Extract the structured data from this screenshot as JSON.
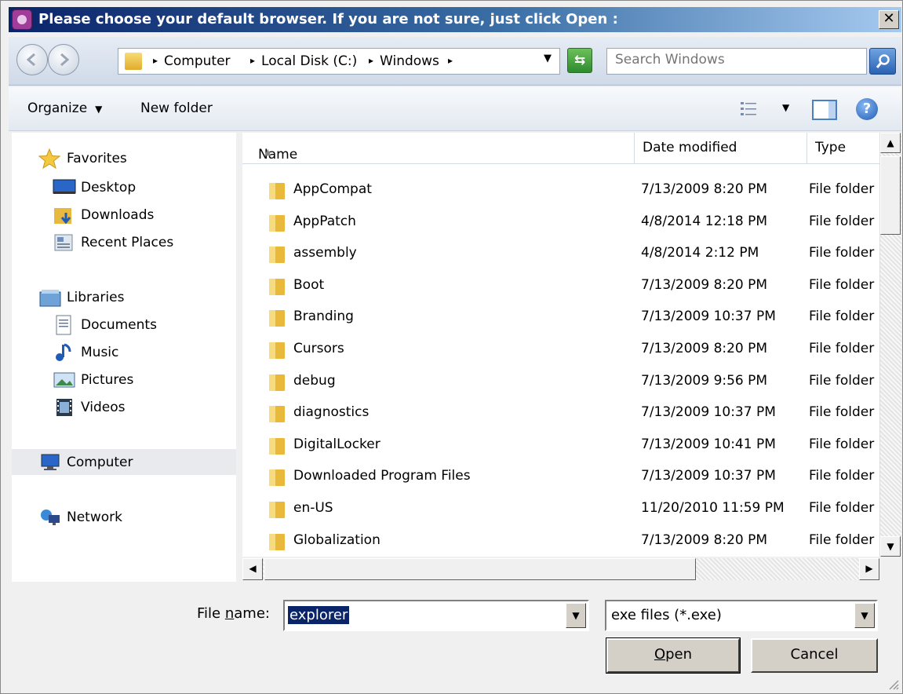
{
  "window": {
    "title": "Please choose your default browser. If you are not sure, just click Open :",
    "close_label": "✕"
  },
  "address": {
    "crumbs": [
      "Computer",
      "Local Disk (C:)",
      "Windows"
    ],
    "search_placeholder": "Search Windows"
  },
  "toolbar": {
    "organize_label": "Organize",
    "new_folder_label": "New folder"
  },
  "nav": {
    "favorites": "Favorites",
    "desktop": "Desktop",
    "downloads": "Downloads",
    "recent": "Recent Places",
    "libraries": "Libraries",
    "documents": "Documents",
    "music": "Music",
    "pictures": "Pictures",
    "videos": "Videos",
    "computer": "Computer",
    "network": "Network"
  },
  "columns": {
    "name": "Name",
    "date": "Date modified",
    "type": "Type"
  },
  "files": [
    {
      "name": "AppCompat",
      "date": "7/13/2009 8:20 PM",
      "type": "File folder"
    },
    {
      "name": "AppPatch",
      "date": "4/8/2014 12:18 PM",
      "type": "File folder"
    },
    {
      "name": "assembly",
      "date": "4/8/2014 2:12 PM",
      "type": "File folder"
    },
    {
      "name": "Boot",
      "date": "7/13/2009 8:20 PM",
      "type": "File folder"
    },
    {
      "name": "Branding",
      "date": "7/13/2009 10:37 PM",
      "type": "File folder"
    },
    {
      "name": "Cursors",
      "date": "7/13/2009 8:20 PM",
      "type": "File folder"
    },
    {
      "name": "debug",
      "date": "7/13/2009 9:56 PM",
      "type": "File folder"
    },
    {
      "name": "diagnostics",
      "date": "7/13/2009 10:37 PM",
      "type": "File folder"
    },
    {
      "name": "DigitalLocker",
      "date": "7/13/2009 10:41 PM",
      "type": "File folder"
    },
    {
      "name": "Downloaded Program Files",
      "date": "7/13/2009 10:37 PM",
      "type": "File folder"
    },
    {
      "name": "en-US",
      "date": "11/20/2010 11:59 PM",
      "type": "File folder"
    },
    {
      "name": "Globalization",
      "date": "7/13/2009 8:20 PM",
      "type": "File folder"
    }
  ],
  "bottom": {
    "file_name_label_pre": "File ",
    "file_name_label_u": "n",
    "file_name_label_post": "ame:",
    "file_name_value": "explorer",
    "file_type_value": "exe files (*.exe)",
    "open_u": "O",
    "open_rest": "pen",
    "cancel_label": "Cancel"
  },
  "colors": {
    "selection": "#0a246a",
    "titlebar_start": "#0a246a",
    "titlebar_end": "#a6caf0"
  }
}
